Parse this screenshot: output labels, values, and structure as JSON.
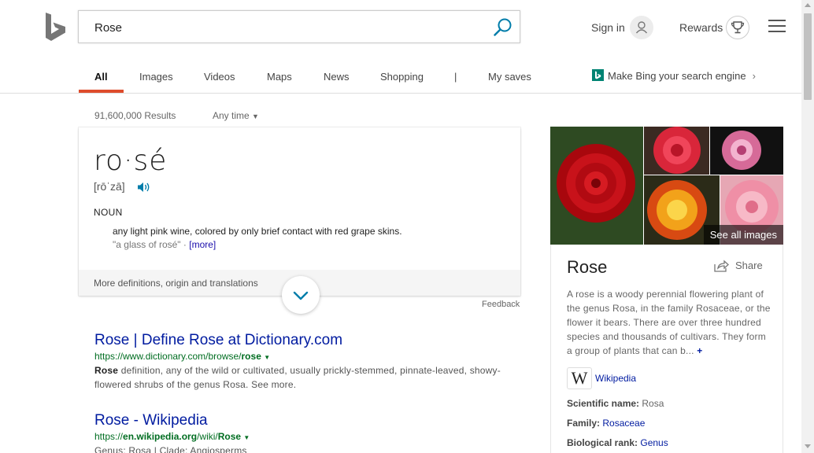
{
  "search": {
    "query": "Rose"
  },
  "header": {
    "signin_label": "Sign in",
    "rewards_label": "Rewards"
  },
  "nav": {
    "tabs": [
      {
        "label": "All",
        "active": true
      },
      {
        "label": "Images"
      },
      {
        "label": "Videos"
      },
      {
        "label": "Maps"
      },
      {
        "label": "News"
      },
      {
        "label": "Shopping"
      },
      {
        "label": "My saves"
      }
    ],
    "separator": "|",
    "promo_label": "Make Bing your search engine"
  },
  "meta": {
    "results_count": "91,600,000 Results",
    "time_filter": "Any time"
  },
  "definition": {
    "word": "ro·sé",
    "pronunciation": "[rōˈzā]",
    "part_of_speech": "NOUN",
    "meaning": "any light pink wine, colored by only brief contact with red grape skins.",
    "example": "\"a glass of rosé\" · ",
    "more_label": "[more]",
    "footer_label": "More definitions, origin and translations",
    "feedback_label": "Feedback"
  },
  "results": [
    {
      "title": "Rose | Define Rose at Dictionary.com",
      "url_prefix": "https://www.dictionary.com/browse/",
      "url_bold": "rose",
      "snippet_bold": "Rose",
      "snippet": " definition, any of the wild or cultivated, usually prickly-stemmed, pinnate-leaved, showy-flowered shrubs of the genus Rosa. See more."
    },
    {
      "title": "Rose - Wikipedia",
      "url_prefix": "https://",
      "url_mid_bold": "en.wikipedia.org",
      "url_mid": "/wiki/",
      "url_bold": "Rose",
      "snippet_partial": "Genus: Rosa   |   Clade: Angiosperms"
    }
  ],
  "knowledge_panel": {
    "see_all_images": "See all images",
    "title": "Rose",
    "share_label": "Share",
    "description": "A rose is a woody perennial flowering plant of the genus Rosa, in the family Rosaceae, or the flower it bears. There are over three hundred species and thousands of cultivars. They form a group of plants that can b...",
    "plus_label": "+",
    "wiki_label": "Wikipedia",
    "facts": [
      {
        "label": "Scientific name:",
        "value": "Rosa",
        "link": false
      },
      {
        "label": "Family:",
        "value": "Rosaceae",
        "link": true
      },
      {
        "label": "Biological rank:",
        "value": "Genus",
        "link": true
      }
    ]
  },
  "icons": {
    "logo": "bing-logo-icon",
    "search": "search-icon",
    "avatar": "user-avatar-icon",
    "rewards": "trophy-icon",
    "menu": "hamburger-menu-icon",
    "speaker": "speaker-icon",
    "chevron": "chevron-down-icon",
    "share": "share-icon"
  },
  "colors": {
    "accent": "#de4c2c",
    "link": "#001ba0",
    "url": "#006d21",
    "bing_teal": "#008373"
  }
}
